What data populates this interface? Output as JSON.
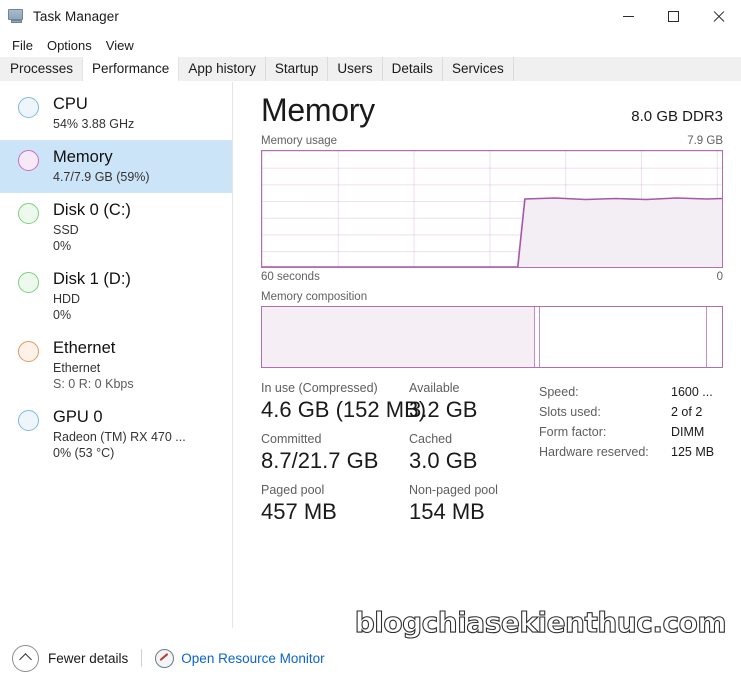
{
  "window": {
    "title": "Task Manager",
    "icon": "task-manager-icon",
    "controls": {
      "minimize": "–",
      "maximize": "□",
      "close": "✕"
    }
  },
  "menu": {
    "items": [
      "File",
      "Options",
      "View"
    ]
  },
  "tabs": {
    "items": [
      "Processes",
      "Performance",
      "App history",
      "Startup",
      "Users",
      "Details",
      "Services"
    ],
    "active": "Performance"
  },
  "sidebar": {
    "items": [
      {
        "name": "CPU",
        "dot": "#7fb8de",
        "lines": [
          "54%  3.88 GHz"
        ],
        "selected": false
      },
      {
        "name": "Memory",
        "dot": "#d77fd2",
        "lines": [
          "4.7/7.9 GB (59%)"
        ],
        "selected": true
      },
      {
        "name": "Disk 0 (C:)",
        "dot": "#7ed07e",
        "lines": [
          "SSD",
          "0%"
        ],
        "selected": false
      },
      {
        "name": "Disk 1 (D:)",
        "dot": "#7ed07e",
        "lines": [
          "HDD",
          "0%"
        ],
        "selected": false
      },
      {
        "name": "Ethernet",
        "dot": "#e0a06a",
        "lines": [
          "Ethernet",
          "S: 0 R: 0 Kbps"
        ],
        "selected": false
      },
      {
        "name": "GPU 0",
        "dot": "#7fb8de",
        "lines": [
          "Radeon (TM) RX 470 ...",
          "0%  (53 °C)"
        ],
        "selected": false
      }
    ]
  },
  "main": {
    "title": "Memory",
    "subtitle": "8.0 GB DDR3",
    "usage_label": "Memory usage",
    "usage_max": "7.9 GB",
    "axis_left": "60 seconds",
    "axis_right": "0",
    "composition_label": "Memory composition"
  },
  "chart_data": {
    "type": "area",
    "title": "Memory usage",
    "xlabel": "60 seconds",
    "ylabel": "Memory",
    "ylim": [
      0,
      7.9
    ],
    "ytick_label_max": "7.9 GB",
    "xtick_labels": [
      "60 seconds",
      "0"
    ],
    "grid": true,
    "line_color": "#a857a8",
    "fill_color": "#f3eef3",
    "x": [
      0,
      10,
      20,
      30,
      40,
      55,
      56,
      58,
      62,
      66,
      70,
      74,
      78,
      82,
      86,
      90,
      94,
      100
    ],
    "y": [
      0,
      0,
      0,
      0,
      0,
      0,
      4.66,
      4.66,
      4.63,
      4.68,
      4.66,
      4.63,
      4.68,
      4.65,
      4.69,
      4.64,
      4.68,
      4.66
    ],
    "note": "x is percent of 60-second window (left=oldest); y is GB in use out of 7.9 GB"
  },
  "composition": {
    "type": "segments",
    "total_gb": 7.9,
    "segments": [
      {
        "name": "in-use",
        "fraction": 0.592,
        "fill": "#f5eef5"
      },
      {
        "name": "modified-divider",
        "fraction": 0.006,
        "fill": "#e6d7e6"
      },
      {
        "name": "standby-free",
        "fraction": 0.372,
        "fill": "#ffffff"
      },
      {
        "name": "free",
        "fraction": 0.03,
        "fill": "#ffffff"
      }
    ],
    "divider_positions_pct": [
      59.2,
      60.0,
      96.5
    ]
  },
  "stats": {
    "left": [
      [
        {
          "label": "In use (Compressed)",
          "value": "4.6 GB (152 MB)"
        },
        {
          "label": "Available",
          "value": "3.2 GB"
        }
      ],
      [
        {
          "label": "Committed",
          "value": "8.7/21.7 GB"
        },
        {
          "label": "Cached",
          "value": "3.0 GB"
        }
      ],
      [
        {
          "label": "Paged pool",
          "value": "457 MB"
        },
        {
          "label": "Non-paged pool",
          "value": "154 MB"
        }
      ]
    ],
    "right": [
      {
        "key": "Speed:",
        "value": "1600 ..."
      },
      {
        "key": "Slots used:",
        "value": "2 of 2"
      },
      {
        "key": "Form factor:",
        "value": "DIMM"
      },
      {
        "key": "Hardware reserved:",
        "value": "125 MB"
      }
    ]
  },
  "statusbar": {
    "fewer_details": "Fewer details",
    "open_resource_monitor": "Open Resource Monitor"
  },
  "watermark": {
    "text": "blogchiasekienthuc.com"
  },
  "colors": {
    "accent_purple": "#b06fb3",
    "line_purple": "#a857a8",
    "selection_blue": "#cce4f7",
    "link_blue": "#0b63ce"
  }
}
